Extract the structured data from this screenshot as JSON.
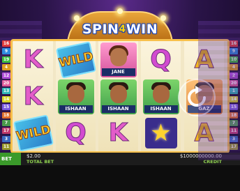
{
  "game": {
    "logo_part1": "SPIN",
    "logo_four": "4",
    "logo_part2": "WIN"
  },
  "reels": [
    [
      "K",
      "K",
      "WILD"
    ],
    [
      "WILD",
      "ISHAAN",
      "Q"
    ],
    [
      "JANE",
      "ISHAAN",
      "K"
    ],
    [
      "Q",
      "ISHAAN",
      "star"
    ],
    [
      "A",
      "GAZ",
      "A"
    ]
  ],
  "symbols": {
    "wild_label": "WILD",
    "jane_label": "JANE",
    "ishaan_label": "ISHAAN",
    "gaz_label": "GAZ"
  },
  "paylines": {
    "left": [
      "16",
      "9",
      "19",
      "4",
      "12",
      "20",
      "13",
      "14",
      "15",
      "18",
      "7",
      "17",
      "3",
      "11"
    ],
    "right": [
      "16",
      "9",
      "10",
      "4",
      "2",
      "20",
      "1",
      "14",
      "15",
      "18",
      "7",
      "11",
      "3",
      "17"
    ]
  },
  "footer": {
    "bet_tab": "BET",
    "total_bet_value": "$2.00",
    "total_bet_label": "TOTAL BET",
    "credit_value": "$1000000000.00",
    "credit_label": "CREDIT"
  },
  "colors": {
    "frame": "#f7c04c",
    "bet_green": "#3a9a2a",
    "label_green": "#8fd14f"
  }
}
